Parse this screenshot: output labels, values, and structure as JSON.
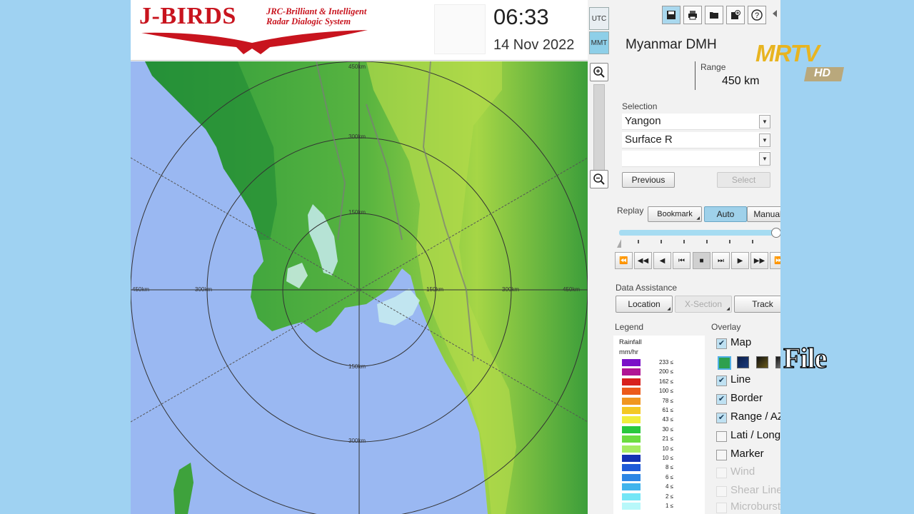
{
  "header": {
    "logo_title": "J-BIRDS",
    "logo_sub_line1": "JRC-Brilliant & Intelligent",
    "logo_sub_line2": "Radar Dialogic System",
    "time": "06:33",
    "date": "14 Nov 2022",
    "tz_utc": "UTC",
    "tz_mmt": "MMT"
  },
  "map": {
    "ring_labels": [
      "450km",
      "300km",
      "150km"
    ],
    "colors": {
      "sea": "#9ab8f2",
      "land_dark": "#2f9a3e",
      "land_light": "#a8d845",
      "rain_echo": "#c8ecf0"
    }
  },
  "panel": {
    "station": "Myanmar DMH",
    "range_label": "Range",
    "range_value": "450 km",
    "selection_label": "Selection",
    "selection_values": [
      "Yangon",
      "Surface R",
      ""
    ],
    "previous_label": "Previous",
    "select_label": "Select",
    "replay_label": "Replay",
    "bookmark_label": "Bookmark",
    "auto_label": "Auto",
    "manual_label": "Manual",
    "replay_progress": 1.0,
    "data_assistance_label": "Data Assistance",
    "location_label": "Location",
    "xsection_label": "X-Section",
    "track_label": "Track",
    "legend_label": "Legend",
    "legend_title1": "Rainfall",
    "legend_title2": "mm/hr",
    "legend": [
      {
        "value": "233 ≤",
        "color": "#7a10c8"
      },
      {
        "value": "200 ≤",
        "color": "#b01494"
      },
      {
        "value": "162 ≤",
        "color": "#d8201c"
      },
      {
        "value": "100 ≤",
        "color": "#ec5a1a"
      },
      {
        "value": "78 ≤",
        "color": "#f09620"
      },
      {
        "value": "61 ≤",
        "color": "#f4c824"
      },
      {
        "value": "43 ≤",
        "color": "#f0ee3c"
      },
      {
        "value": "30 ≤",
        "color": "#28c83c"
      },
      {
        "value": "21 ≤",
        "color": "#6cdc40"
      },
      {
        "value": "10 ≤",
        "color": "#a6ec62"
      },
      {
        "value": "10 ≤",
        "color": "#1432b4"
      },
      {
        "value": "8 ≤",
        "color": "#1e5ad8"
      },
      {
        "value": "6 ≤",
        "color": "#2c86e4"
      },
      {
        "value": "4 ≤",
        "color": "#40b4ec"
      },
      {
        "value": "2 ≤",
        "color": "#74e6f6"
      },
      {
        "value": "1 ≤",
        "color": "#b8f8fa"
      }
    ],
    "overlay_label": "Overlay",
    "overlays": [
      {
        "label": "Map",
        "checked": true,
        "enabled": true
      },
      {
        "label": "Line",
        "checked": true,
        "enabled": true
      },
      {
        "label": "Border",
        "checked": true,
        "enabled": true
      },
      {
        "label": "Range / AZ",
        "checked": true,
        "enabled": true
      },
      {
        "label": "Lati / Long",
        "checked": false,
        "enabled": true
      },
      {
        "label": "Marker",
        "checked": false,
        "enabled": true
      },
      {
        "label": "Wind",
        "checked": false,
        "enabled": false
      },
      {
        "label": "Shear Line",
        "checked": false,
        "enabled": false
      },
      {
        "label": "Microburst",
        "checked": false,
        "enabled": false
      }
    ]
  },
  "overlay_watermark": {
    "channel": "MRTV",
    "channel_sub": "HD",
    "caption": "File"
  }
}
